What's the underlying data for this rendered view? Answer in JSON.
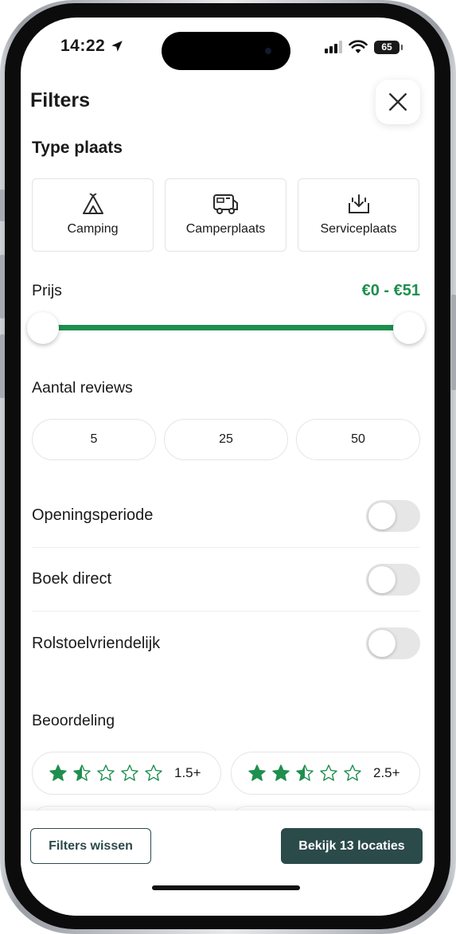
{
  "status_bar": {
    "time": "14:22",
    "battery": "65"
  },
  "header": {
    "title": "Filters"
  },
  "type_section": {
    "title": "Type plaats",
    "options": [
      {
        "label": "Camping",
        "icon": "tent-icon"
      },
      {
        "label": "Camperplaats",
        "icon": "camper-icon"
      },
      {
        "label": "Serviceplaats",
        "icon": "service-icon"
      }
    ]
  },
  "price": {
    "label": "Prijs",
    "range": "€0 - €51",
    "min_fraction": 0,
    "max_fraction": 1
  },
  "reviews": {
    "label": "Aantal reviews",
    "options": [
      "5",
      "25",
      "50"
    ]
  },
  "toggles": [
    {
      "label": "Openingsperiode",
      "on": false
    },
    {
      "label": "Boek direct",
      "on": false
    },
    {
      "label": "Rolstoelvriendelijk",
      "on": false
    }
  ],
  "rating": {
    "label": "Beoordeling",
    "options": [
      {
        "value": "1.5+",
        "stars": 1.5
      },
      {
        "value": "2.5+",
        "stars": 2.5
      }
    ]
  },
  "footer": {
    "clear_label": "Filters wissen",
    "show_label": "Bekijk 13 locaties"
  },
  "colors": {
    "accent": "#1e8f4e",
    "primary_dark": "#2b4a4a",
    "star": "#1e8f4e"
  }
}
